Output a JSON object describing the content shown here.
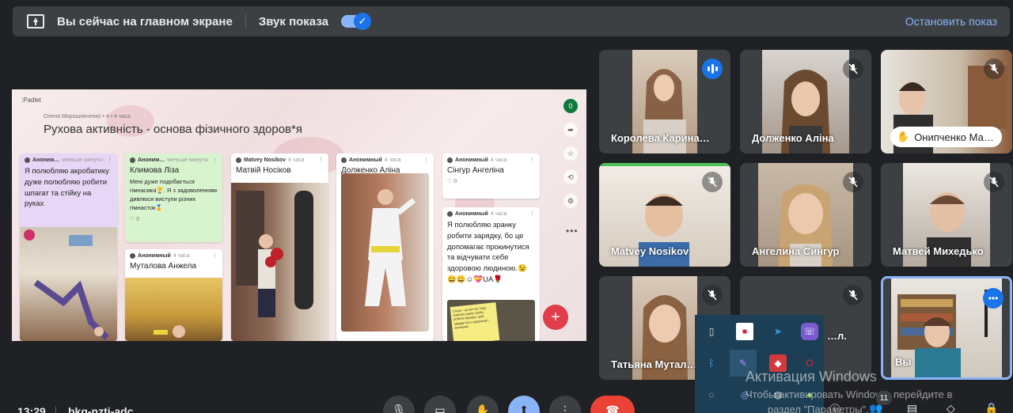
{
  "banner": {
    "home_text": "Вы сейчас на главном экране",
    "sound_label": "Звук показа",
    "sound_on": true,
    "stop_label": "Остановить показ"
  },
  "padlet": {
    "logo": ":Padlet",
    "author": "Олена Мирошниченко • 4 • 4 часа",
    "title": "Рухова активнiсть - основа фiзичного здоров*я",
    "like_count": "0",
    "cards": {
      "c1": {
        "author": "Аноним…",
        "time": "меньше минуты",
        "body": "Я полюбляю акробатику дуже полюбляю робити шпагат та стійку на руках"
      },
      "c2": {
        "author": "Аноним…",
        "time": "меньше минуты",
        "title": "Климова Ліза",
        "body": "Мені дуже подобається гімнасика🏆. Я з задоволенням дивлюся виступи різних гімнасток🏅",
        "likes": "0"
      },
      "c3": {
        "author": "Анонимный",
        "time": "4 часа",
        "title": "Муталова Анжела"
      },
      "c4": {
        "author": "Matvey Nosikov",
        "time": "4 часа",
        "title": "Матвій Носіков"
      },
      "c5": {
        "author": "Анонимный",
        "time": "4 часа",
        "title": "Долженко Аліна"
      },
      "c6": {
        "author": "Анонимный",
        "time": "4 часа",
        "title": "Сінгур Ангеліна",
        "likes": "0"
      },
      "c7": {
        "author": "Анонимный",
        "time": "4 часа",
        "body": "Я полюбляю зранку робити зарядку, бо це допомагає прокинутися та відчувати себе здоровою людиною.😉😄😀☺💝UA🌹",
        "note": "Спорт - це життя! Тому кожного ранку треба робити зарядку, щоб завжди бути здоровим і активним"
      }
    }
  },
  "participants": [
    {
      "name": "Королева Карина…",
      "state": "speaking"
    },
    {
      "name": "Долженко Аліна",
      "state": "muted"
    },
    {
      "name": "Онипченко Ма…",
      "state": "hand-raised"
    },
    {
      "name": "Matvey Nosikov",
      "state": "muted"
    },
    {
      "name": "Ангелина Сингур",
      "state": "muted"
    },
    {
      "name": "Матвей Михедько",
      "state": "muted"
    },
    {
      "name": "Татьяна Мутал…",
      "state": "muted"
    },
    {
      "name": "…л.",
      "state": "muted"
    },
    {
      "name": "Вы",
      "state": "self"
    }
  ],
  "watermark": {
    "line1": "Активация Windows",
    "line2": "Чтобы активировать Windows, перейдите в",
    "line3": "раздел \"Параметры\"."
  },
  "bottom": {
    "time": "13:29",
    "meeting_code": "bkg-nzti-adc",
    "participants_count": "11"
  },
  "colors": {
    "background": "#202124",
    "accent": "#8ab4f8",
    "meet_blue": "#1a73e8",
    "end_call": "#ea4335",
    "padlet_fab": "#e03c4a"
  }
}
